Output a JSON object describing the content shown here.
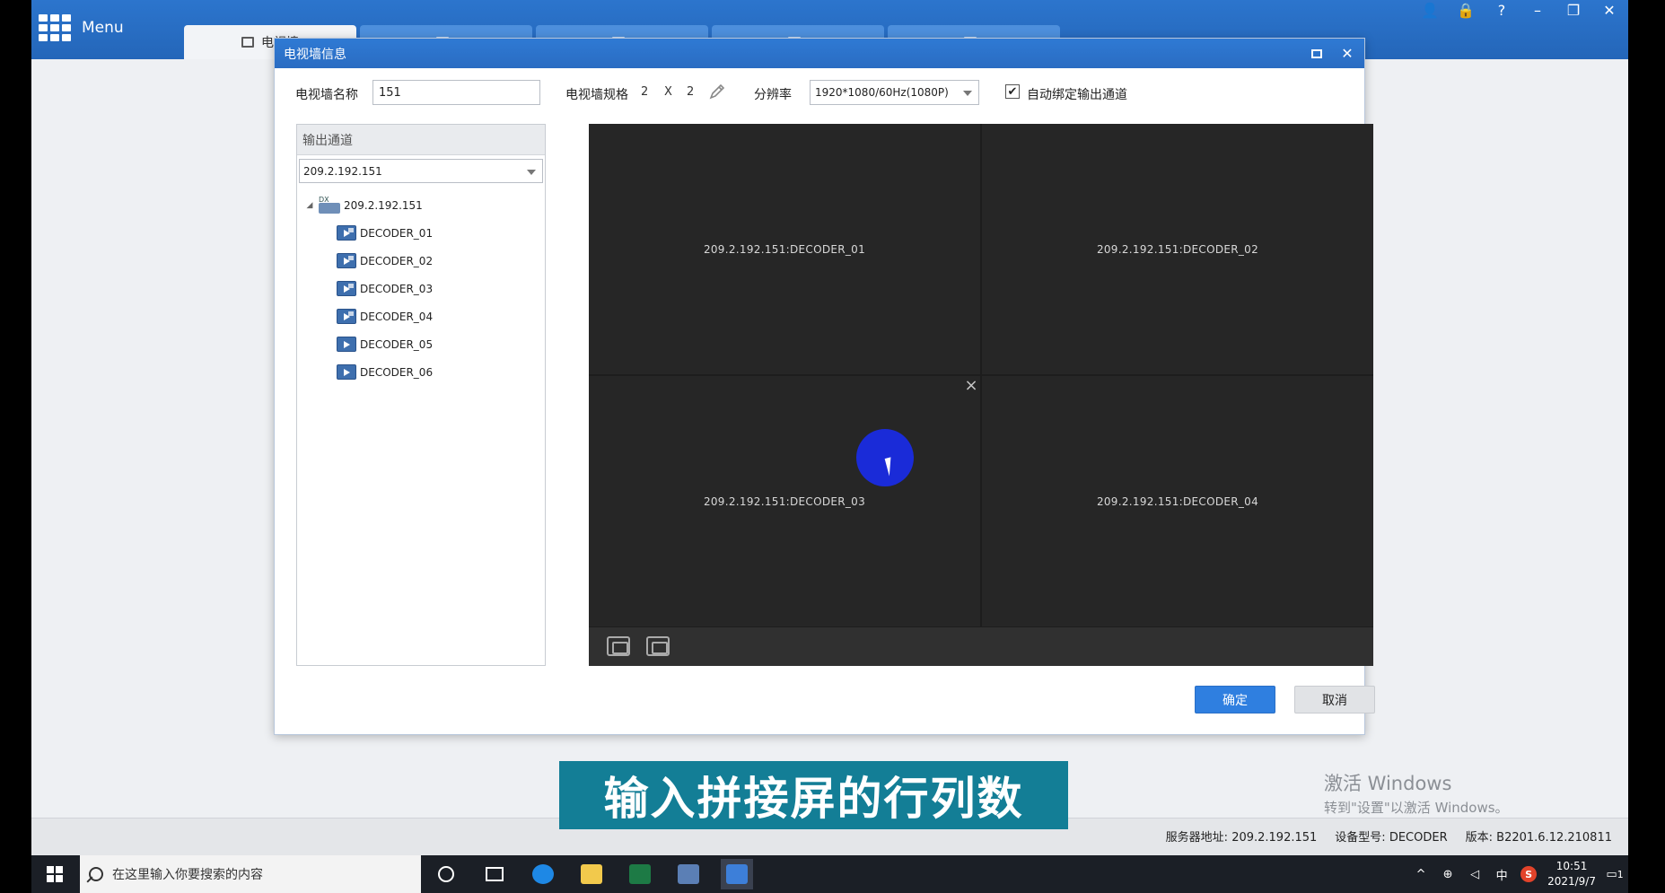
{
  "app": {
    "menu_label": "Menu",
    "tabs": [
      {
        "label": "电视墙",
        "active": true
      },
      {
        "label": "",
        "active": false
      },
      {
        "label": "",
        "active": false
      },
      {
        "label": "",
        "active": false
      },
      {
        "label": "",
        "active": false
      }
    ]
  },
  "dialog": {
    "title": "电视墙信息",
    "name_label": "电视墙名称",
    "name_value": "151",
    "spec_label": "电视墙规格",
    "rows": "2",
    "times": "X",
    "cols": "2",
    "resolution_label": "分辨率",
    "resolution_value": "1920*1080/60Hz(1080P)",
    "auto_bind_label": "自动绑定输出通道",
    "auto_bind_checked": true,
    "ok_label": "确定",
    "cancel_label": "取消"
  },
  "output_panel": {
    "title": "输出通道",
    "device_select": "209.2.192.151",
    "tree": {
      "device": "209.2.192.151",
      "device_tag": "DX",
      "channels": [
        "DECODER_01",
        "DECODER_02",
        "DECODER_03",
        "DECODER_04",
        "DECODER_05",
        "DECODER_06"
      ],
      "linked": [
        true,
        true,
        true,
        true,
        false,
        false
      ]
    }
  },
  "wall": {
    "screens": [
      "209.2.192.151:DECODER_01",
      "209.2.192.151:DECODER_02",
      "209.2.192.151:DECODER_03",
      "209.2.192.151:DECODER_04"
    ],
    "close_glyph": "×"
  },
  "subtitle": "输入拼接屏的行列数",
  "watermark": {
    "title": "激活 Windows",
    "sub": "转到\"设置\"以激活 Windows。"
  },
  "status": {
    "server_label": "服务器地址:",
    "server_value": "209.2.192.151",
    "model_label": "设备型号:",
    "model_value": "DECODER",
    "version_label": "版本:",
    "version_value": "B2201.6.12.210811"
  },
  "taskbar": {
    "search_placeholder": "在这里输入你要搜索的内容",
    "ime": "中",
    "time": "10:51",
    "date": "2021/9/7",
    "notification_count": "1"
  },
  "colors": {
    "topbar": "#2466b9",
    "dialog_title": "#2a6cc2",
    "ok_button": "#2f7fe0",
    "subtitle_bg": "#137e96",
    "cursor_dot": "#1a2bd8"
  }
}
